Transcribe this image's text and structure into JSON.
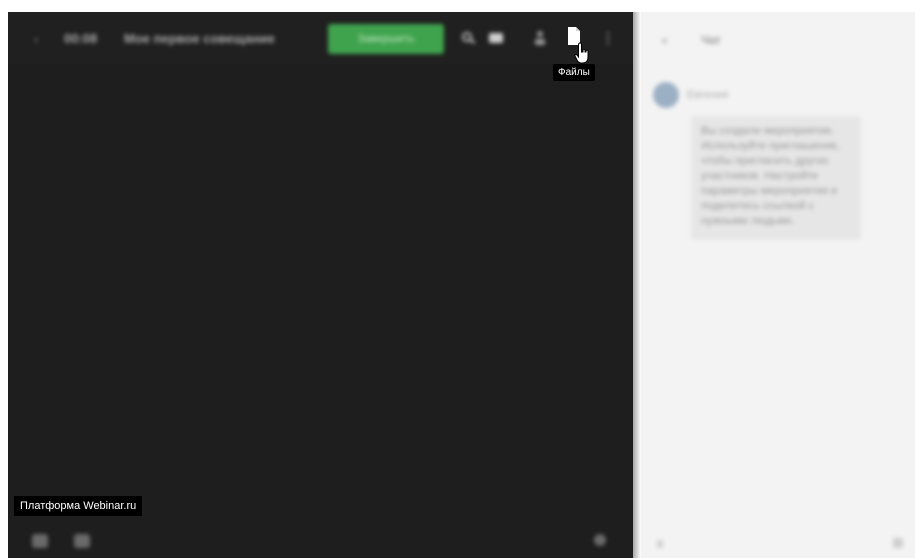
{
  "topbar": {
    "back_icon": "‹",
    "timer": "00:08",
    "title": "Мое первое совещание",
    "action_button": "Завершить",
    "icons": [
      "search-icon",
      "chat-icon",
      "user-icon",
      "file-icon",
      "more-icon"
    ]
  },
  "tooltip": {
    "text": "Файлы"
  },
  "stage": {
    "platform_label": "Платформа Webinar.ru"
  },
  "chat": {
    "close_icon": "×",
    "title": "Чат",
    "author": "Евгения",
    "message": "Вы создали мероприятие. Используйте приглашение, чтобы пригласить других участников. Настройте параметры мероприятия и поделитесь ссылкой с нужными людьми."
  },
  "colors": {
    "stage_bg": "#1e1e1e",
    "accent_green": "#3fa34d",
    "chat_bg": "#f3f3f3"
  }
}
